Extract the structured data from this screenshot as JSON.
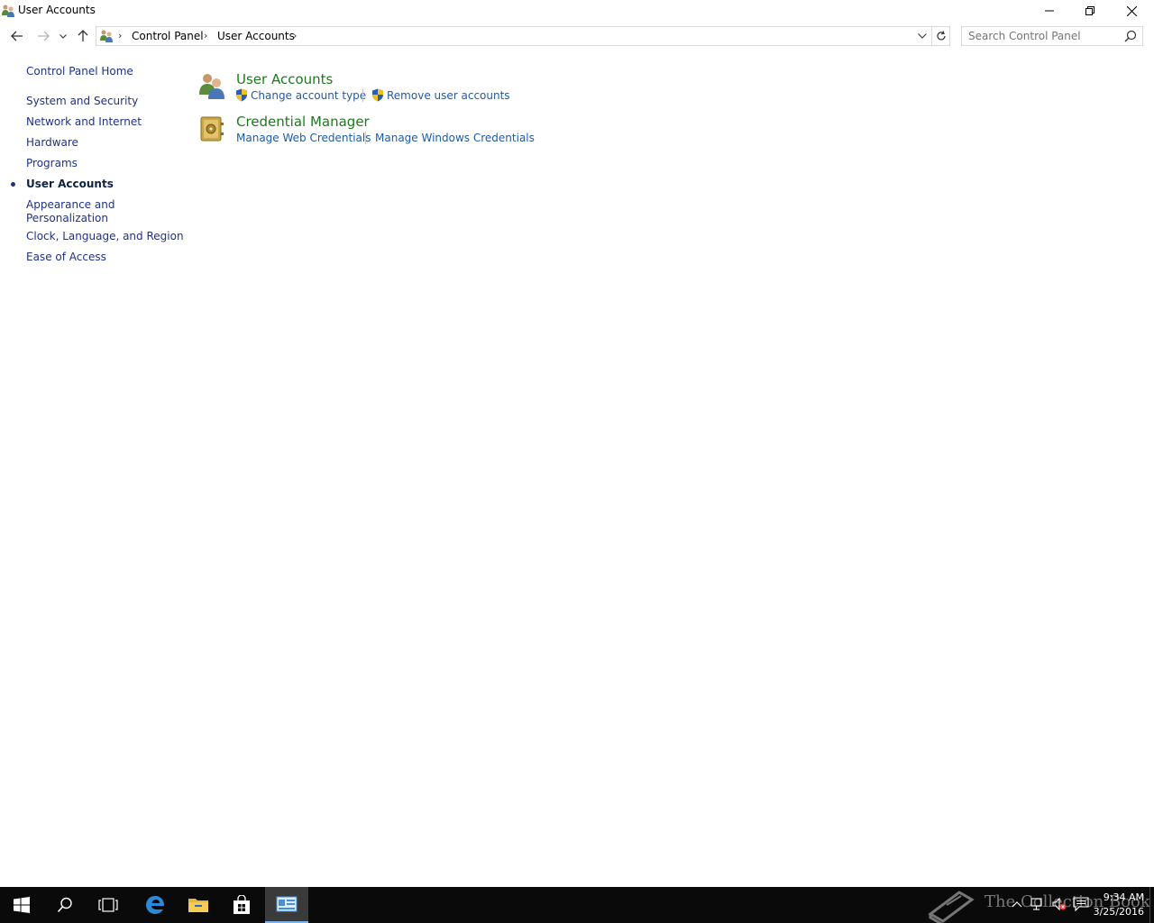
{
  "window": {
    "title": "User Accounts"
  },
  "address": {
    "crumbs": [
      "Control Panel",
      "User Accounts"
    ],
    "search_placeholder": "Search Control Panel"
  },
  "leftnav": {
    "home": "Control Panel Home",
    "items": [
      "System and Security",
      "Network and Internet",
      "Hardware",
      "Programs",
      "User Accounts",
      "Appearance and",
      "Personalization",
      "Clock, Language, and Region",
      "Ease of Access"
    ],
    "active": "User Accounts"
  },
  "categories": [
    {
      "title": "User Accounts",
      "icon": "users-icon",
      "links": [
        "Change account type",
        "Remove user accounts"
      ]
    },
    {
      "title": "Credential Manager",
      "icon": "vault-icon",
      "links": [
        "Manage Web Credentials",
        "Manage Windows Credentials"
      ]
    }
  ],
  "taskbar": {
    "watermark": "The Collection Book",
    "time": "9:34 AM",
    "date": "3/25/2016"
  },
  "colors": {
    "link": "#1e5aa8",
    "category_title": "#1e7a1e",
    "nav": "#1e3287",
    "taskbar": "#0a0a0a"
  }
}
